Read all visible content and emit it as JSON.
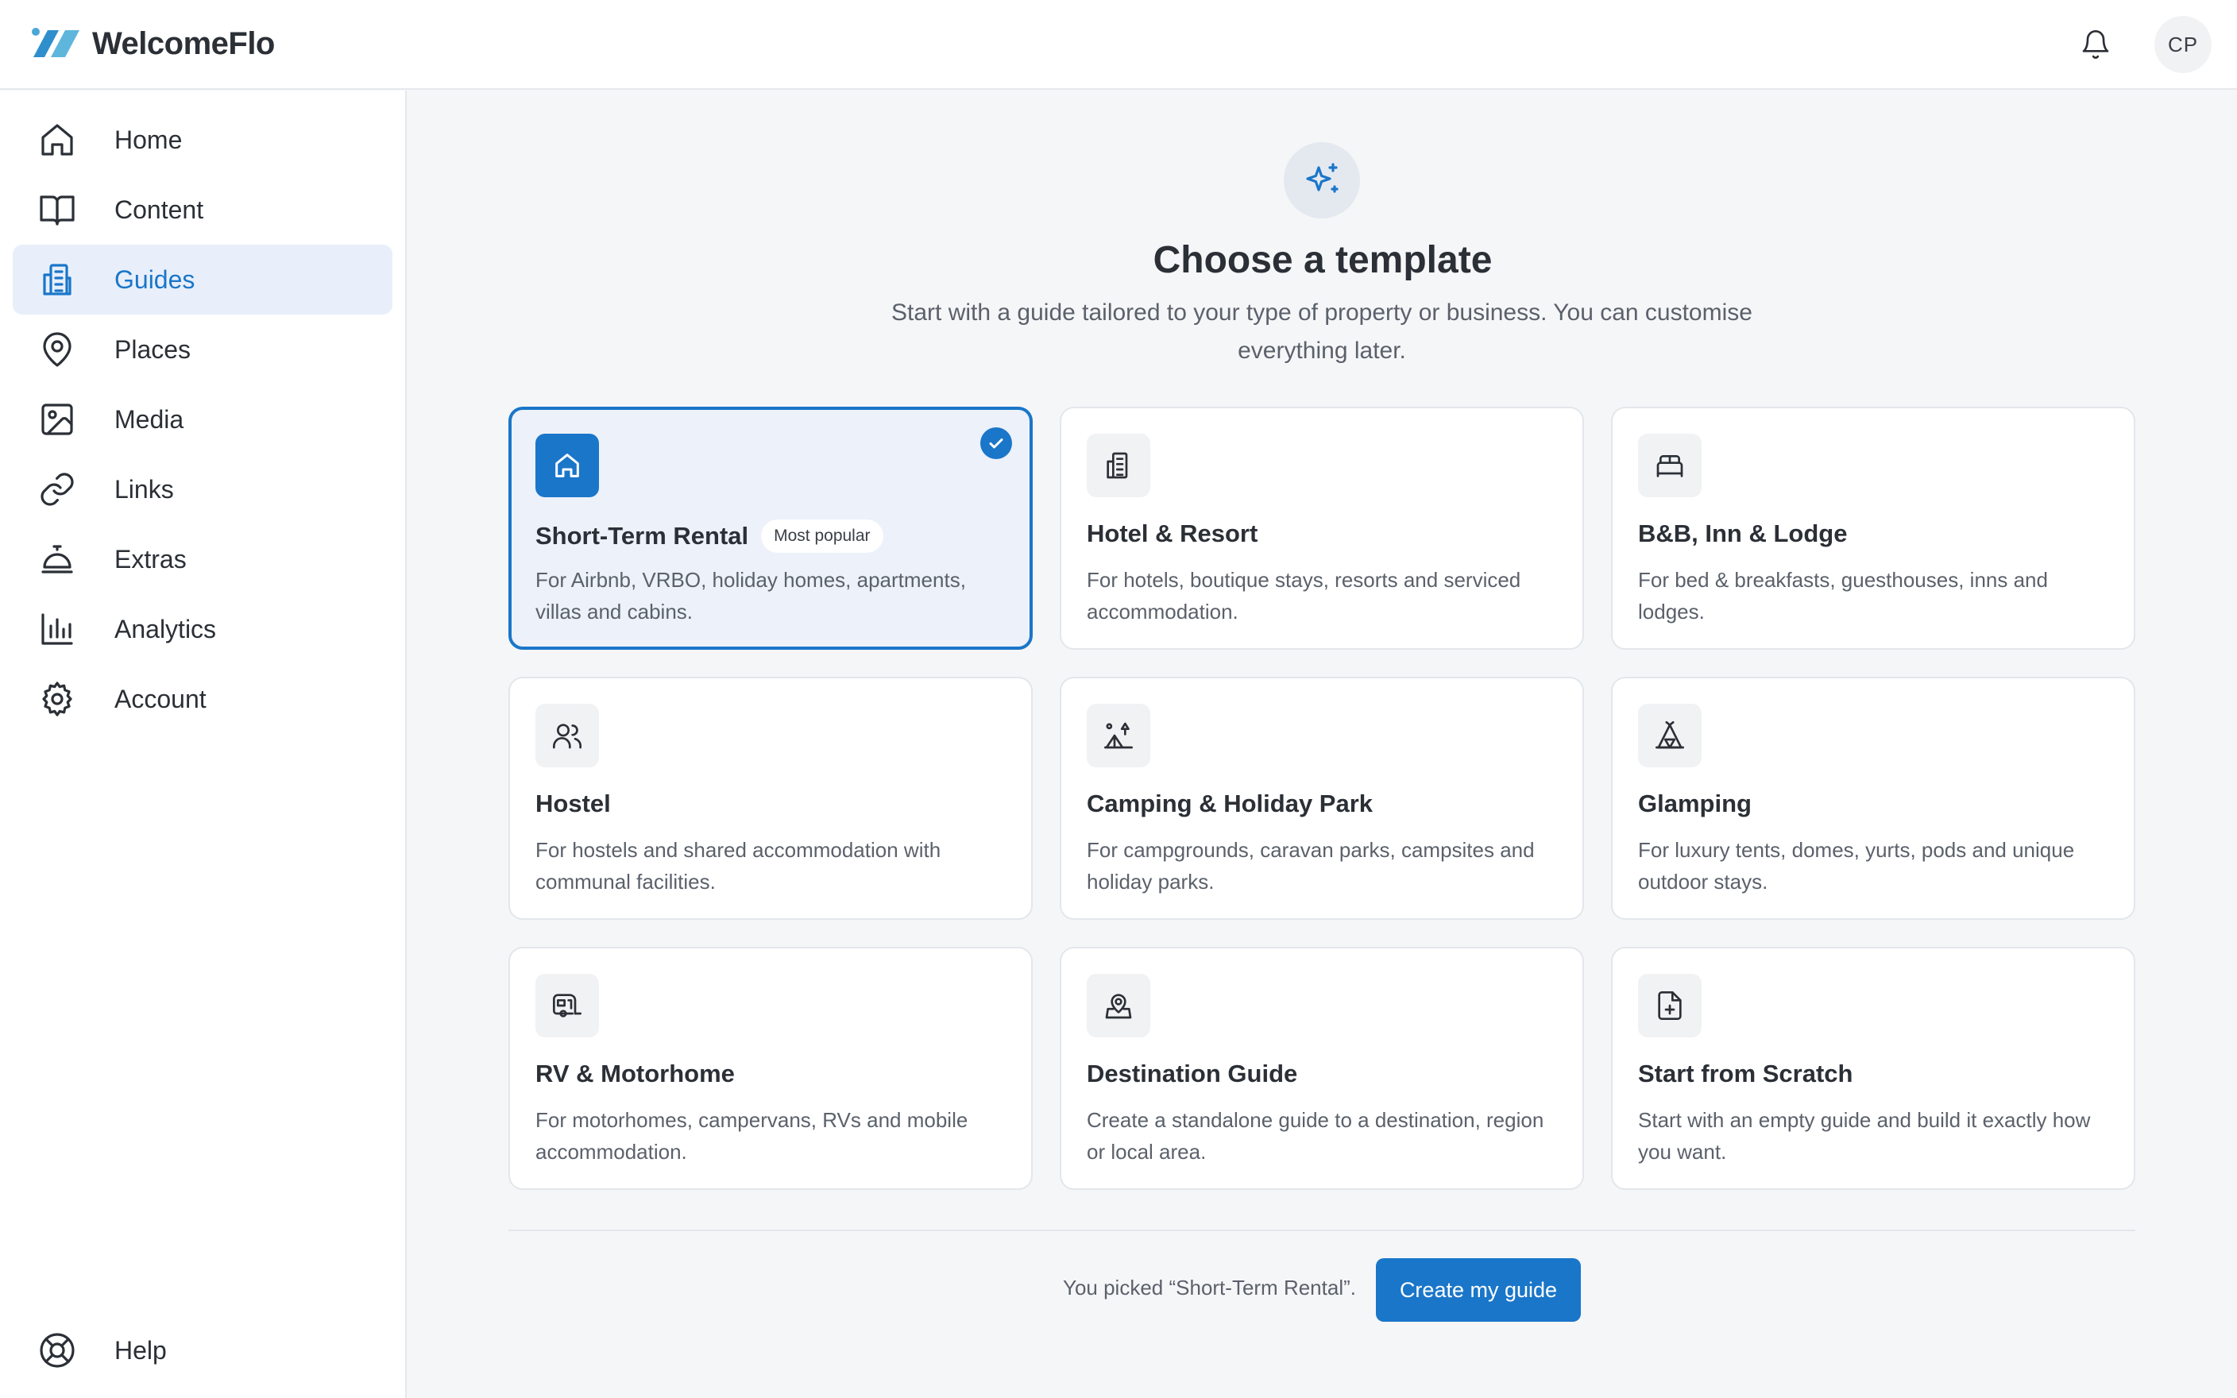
{
  "app": {
    "name": "WelcomeFlo"
  },
  "header": {
    "avatar_initials": "CP"
  },
  "sidebar": {
    "items": [
      {
        "label": "Home",
        "icon": "home-icon"
      },
      {
        "label": "Content",
        "icon": "book-icon"
      },
      {
        "label": "Guides",
        "icon": "building-icon",
        "active": true
      },
      {
        "label": "Places",
        "icon": "map-pin-icon"
      },
      {
        "label": "Media",
        "icon": "image-icon"
      },
      {
        "label": "Links",
        "icon": "link-icon"
      },
      {
        "label": "Extras",
        "icon": "concierge-bell-icon"
      },
      {
        "label": "Analytics",
        "icon": "bar-chart-icon"
      },
      {
        "label": "Account",
        "icon": "gear-icon"
      }
    ],
    "help_label": "Help"
  },
  "main": {
    "title": "Choose a template",
    "subtitle": "Start with a guide tailored to your type of property or business. You can customise everything later.",
    "templates": [
      {
        "title": "Short-Term Rental",
        "badge": "Most popular",
        "desc": "For Airbnb, VRBO, holiday homes, apartments, villas and cabins.",
        "icon": "home-icon",
        "selected": true
      },
      {
        "title": "Hotel & Resort",
        "desc": "For hotels, boutique stays, resorts and serviced accommodation.",
        "icon": "hotel-icon"
      },
      {
        "title": "B&B, Inn & Lodge",
        "desc": "For bed & breakfasts, guesthouses, inns and lodges.",
        "icon": "bed-icon"
      },
      {
        "title": "Hostel",
        "desc": "For hostels and shared accommodation with communal facilities.",
        "icon": "users-icon"
      },
      {
        "title": "Camping & Holiday Park",
        "desc": "For campgrounds, caravan parks, campsites and holiday parks.",
        "icon": "campsite-icon"
      },
      {
        "title": "Glamping",
        "desc": "For luxury tents, domes, yurts, pods and unique outdoor stays.",
        "icon": "tent-icon"
      },
      {
        "title": "RV & Motorhome",
        "desc": "For motorhomes, campervans, RVs and mobile accommodation.",
        "icon": "caravan-icon"
      },
      {
        "title": "Destination Guide",
        "desc": "Create a standalone guide to a destination, region or local area.",
        "icon": "map-pin-user-icon"
      },
      {
        "title": "Start from Scratch",
        "desc": "Start with an empty guide and build it exactly how you want.",
        "icon": "file-plus-icon"
      }
    ],
    "picked_text": "You picked “Short-Term Rental”.",
    "create_label": "Create my guide"
  },
  "colors": {
    "accent": "#1a76c9",
    "active_nav_bg": "#e8effa",
    "selected_card_bg": "#ecf1fa"
  }
}
